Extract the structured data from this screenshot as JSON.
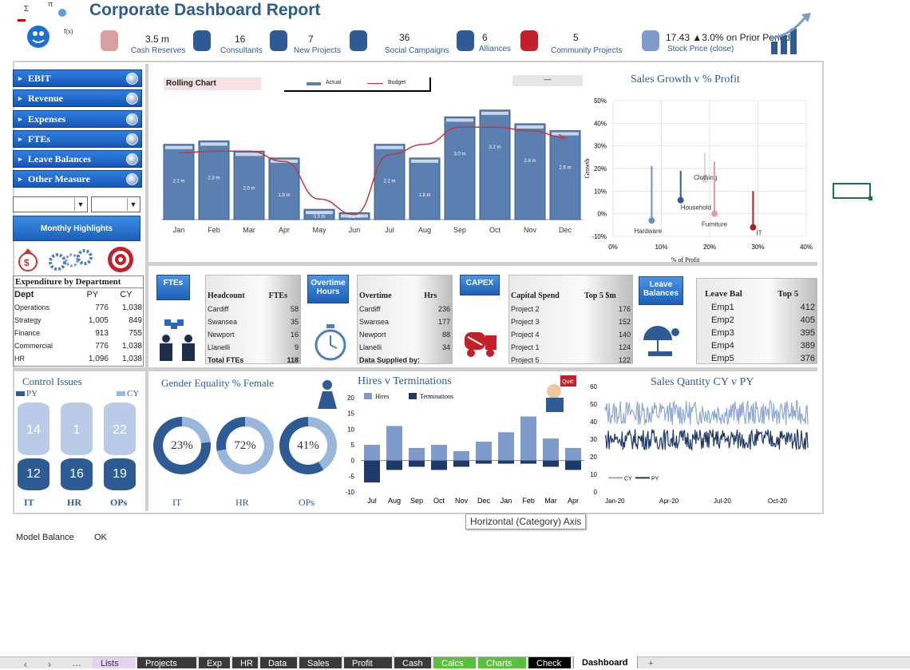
{
  "header": {
    "title": "Corporate Dashboard Report"
  },
  "kpis": [
    {
      "value": "3.5 m",
      "label": "Cash Reserves",
      "icon": "piggy-bank-icon"
    },
    {
      "value": "16",
      "label": "Consultants",
      "icon": "consultant-icon"
    },
    {
      "value": "7",
      "label": "New Projects",
      "icon": "idea-person-icon"
    },
    {
      "value": "36",
      "label": "Social Campaigns",
      "icon": "thumbs-up-icon"
    },
    {
      "value": "6",
      "label": "Alliances",
      "icon": "handshake-people-icon"
    },
    {
      "value": "5",
      "label": "Community Projects",
      "icon": "hands-person-icon"
    },
    {
      "value": "17.43 ▲3.0% on Prior Period",
      "label": "Stock Price (close)",
      "icon": "stock-chart-icon"
    }
  ],
  "nav": {
    "items": [
      "EBIT",
      "Revenue",
      "Expenses",
      "FTEs",
      "Leave Balances",
      "Other Measure"
    ],
    "monthly": "Monthly Highlights"
  },
  "expenditure": {
    "title": "Expenditure by Department",
    "headers": [
      "Dept",
      "PY",
      "CY"
    ],
    "rows": [
      [
        "Operations",
        "776",
        "1,038"
      ],
      [
        "Strategy",
        "1,005",
        "849"
      ],
      [
        "Finance",
        "913",
        "755"
      ],
      [
        "Commercial",
        "776",
        "1,038"
      ],
      [
        "HR",
        "1,096",
        "1,038"
      ]
    ]
  },
  "rolling": {
    "title": "Rolling Chart",
    "legend_actual": "Actual",
    "legend_budget": "Budget",
    "filter": "—"
  },
  "fte": {
    "badge": "FTEs",
    "headers": [
      "Headcount",
      "FTEs"
    ],
    "rows": [
      [
        "Cardiff",
        "58"
      ],
      [
        "Swansea",
        "35"
      ],
      [
        "Newport",
        "16"
      ],
      [
        "Llanelli",
        "9"
      ]
    ],
    "total": [
      "Total FTEs",
      "118"
    ]
  },
  "overtime": {
    "badge": "Overtime Hours",
    "headers": [
      "Overtime",
      "Hrs"
    ],
    "rows": [
      [
        "Cardiff",
        "236"
      ],
      [
        "Swansea",
        "177"
      ],
      [
        "Newport",
        "88"
      ],
      [
        "Llanelli",
        "34"
      ]
    ],
    "footer": "Data Supplied by:"
  },
  "capex": {
    "badge": "CAPEX",
    "headers": [
      "Capital Spend",
      "Top 5 $m"
    ],
    "rows": [
      [
        "Project 2",
        "176"
      ],
      [
        "Project 3",
        "152"
      ],
      [
        "Project 4",
        "140"
      ],
      [
        "Project 1",
        "124"
      ],
      [
        "Project 5",
        "122"
      ]
    ]
  },
  "leave": {
    "badge": "Leave Balances",
    "headers": [
      "Leave Bal",
      "Top 5"
    ],
    "rows": [
      [
        "Emp1",
        "412"
      ],
      [
        "Emp2",
        "405"
      ],
      [
        "Emp3",
        "395"
      ],
      [
        "Emp4",
        "389"
      ],
      [
        "Emp5",
        "376"
      ]
    ]
  },
  "control": {
    "title": "Control Issues",
    "py": "PY",
    "cy": "CY",
    "cols": [
      "IT",
      "HR",
      "OPs"
    ],
    "py_vals": [
      "14",
      "1",
      "22"
    ],
    "cy_vals": [
      "12",
      "16",
      "19"
    ]
  },
  "gender": {
    "title": "Gender Equality % Female",
    "items": [
      {
        "label": "IT",
        "text": "23%",
        "value": 0.23
      },
      {
        "label": "HR",
        "text": "72%",
        "value": 0.72
      },
      {
        "label": "OPs",
        "text": "41%",
        "value": 0.41
      }
    ]
  },
  "tooltip": "Horizontal (Category) Axis",
  "footer": {
    "label": "Model Balance",
    "value": "OK"
  },
  "tabs": [
    "Lists",
    "Projects",
    "Exp",
    "HR",
    "Data",
    "Sales",
    "Profit",
    "Cash",
    "Calcs",
    "Charts",
    "Check",
    "Dashboard",
    "+"
  ],
  "colors": {
    "accent": "#2e5b93",
    "bar": "#5b7fb0",
    "budget": "#c0393b",
    "dark": "#1f3a66",
    "light": "#9bb6db"
  },
  "chart_data": [
    {
      "type": "bar",
      "title": "Rolling Chart",
      "categories": [
        "Jan",
        "Feb",
        "Mar",
        "Apr",
        "May",
        "Jun",
        "Jul",
        "Aug",
        "Sep",
        "Oct",
        "Nov",
        "Dec"
      ],
      "series": [
        {
          "name": "Actual",
          "values": [
            2.2,
            2.3,
            2.0,
            1.8,
            0.3,
            0.2,
            2.2,
            1.8,
            3.0,
            3.2,
            2.8,
            2.6
          ]
        },
        {
          "name": "Budget",
          "values": [
            1.95,
            2.0,
            2.0,
            1.7,
            0.6,
            0.15,
            1.9,
            2.2,
            2.7,
            2.7,
            2.6,
            2.4
          ]
        }
      ],
      "labels": [
        "2.2 m",
        "2.3 m",
        "2.0 m",
        "1.8 m",
        "0.3 m",
        "0.2 m",
        "2.2 m",
        "1.8 m",
        "3.0 m",
        "3.2 m",
        "2.8 m",
        "2.6 m"
      ],
      "ylim": [
        0,
        3.5
      ]
    },
    {
      "type": "scatter",
      "title": "Sales Growth v % Profit",
      "xlabel": "% of Profit",
      "ylabel": "Growth",
      "xticks": [
        "0%",
        "10%",
        "20%",
        "30%",
        "40%"
      ],
      "yticks": [
        "-10%",
        "0%",
        "10%",
        "20%",
        "30%",
        "40%",
        "50%"
      ],
      "xlim": [
        0,
        40
      ],
      "ylim": [
        -10,
        50
      ],
      "points": [
        {
          "name": "Hardware",
          "x": 8,
          "y": -3,
          "top": 21,
          "color": "#6d8fc4"
        },
        {
          "name": "Clothing",
          "x": 19,
          "y": 15,
          "top": 27,
          "color": "#cfd9ea"
        },
        {
          "name": "Household",
          "x": 14,
          "y": 6,
          "top": 19,
          "color": "#2e5b93"
        },
        {
          "name": "Furniture",
          "x": 21,
          "y": 0,
          "top": 23,
          "color": "#e59a9c"
        },
        {
          "name": "IT",
          "x": 29,
          "y": -6,
          "top": 10,
          "color": "#a3222a"
        }
      ]
    },
    {
      "type": "bar",
      "title": "Hires v Terminations",
      "categories": [
        "Jul",
        "Aug",
        "Sep",
        "Oct",
        "Nov",
        "Dec",
        "Jan",
        "Feb",
        "Mar",
        "Apr"
      ],
      "ylim": [
        -10,
        20
      ],
      "yticks": [
        "-10",
        "-5",
        "0",
        "5",
        "10",
        "15",
        "20"
      ],
      "series": [
        {
          "name": "Hires",
          "values": [
            5,
            11,
            4,
            5,
            3,
            6,
            9,
            14,
            7,
            4
          ]
        },
        {
          "name": "Terminations",
          "values": [
            -7,
            -3,
            -2,
            -3,
            -2,
            -1,
            -1,
            -1,
            -2,
            -3
          ]
        }
      ]
    },
    {
      "type": "line",
      "title": "Sales Qantity CY v PY",
      "xticks": [
        "Jan-20",
        "Apr-20",
        "Jul-20",
        "Oct-20"
      ],
      "yticks": [
        "0",
        "10",
        "20",
        "30",
        "40",
        "50",
        "60"
      ],
      "ylim": [
        0,
        60
      ],
      "series": [
        {
          "name": "CY",
          "mean": 45,
          "amp": 7
        },
        {
          "name": "PY",
          "mean": 30,
          "amp": 6
        }
      ]
    }
  ]
}
